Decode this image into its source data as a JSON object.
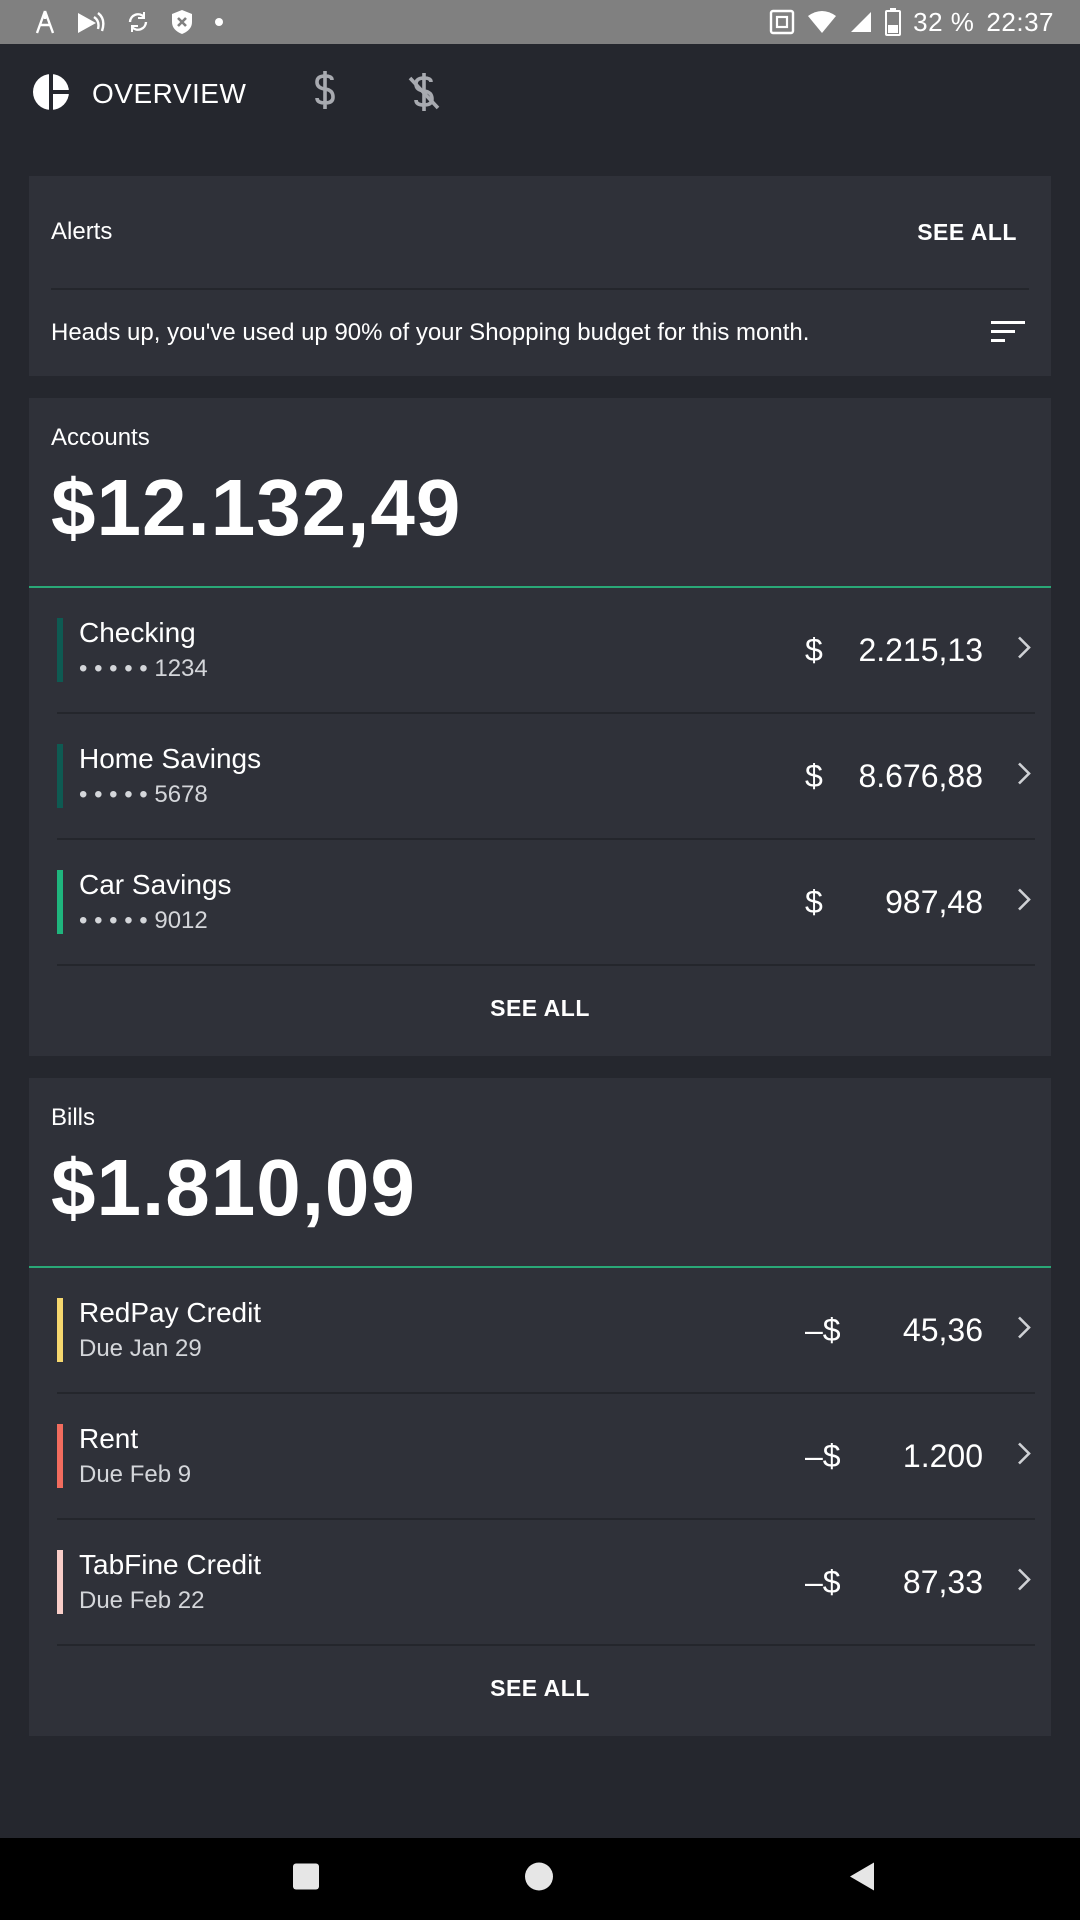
{
  "status_bar": {
    "battery_percent": "32 %",
    "time": "22:37"
  },
  "tabs": {
    "overview_label": "OVERVIEW"
  },
  "alerts": {
    "title": "Alerts",
    "see_all": "SEE ALL",
    "message": "Heads up, you've used up 90% of your Shopping budget for this month."
  },
  "accounts": {
    "title": "Accounts",
    "total": "$12.132,49",
    "see_all": "SEE ALL",
    "items": [
      {
        "name": "Checking",
        "sub": "• • • • • 1234",
        "currency": "$",
        "amount": "2.215,13",
        "color": "#0e5a52"
      },
      {
        "name": "Home Savings",
        "sub": "• • • • • 5678",
        "currency": "$",
        "amount": "8.676,88",
        "color": "#0e5a52"
      },
      {
        "name": "Car Savings",
        "sub": "• • • • • 9012",
        "currency": "$",
        "amount": "987,48",
        "color": "#1fb57d"
      }
    ]
  },
  "bills": {
    "title": "Bills",
    "total": "$1.810,09",
    "see_all": "SEE ALL",
    "items": [
      {
        "name": "RedPay Credit",
        "sub": "Due Jan 29",
        "currency": "–$",
        "amount": "45,36",
        "color": "#f5d76e"
      },
      {
        "name": "Rent",
        "sub": "Due Feb 9",
        "currency": "–$",
        "amount": "1.200",
        "color": "#f26c5e"
      },
      {
        "name": "TabFine Credit",
        "sub": "Due Feb 22",
        "currency": "–$",
        "amount": "87,33",
        "color": "#f8cdc8"
      }
    ]
  },
  "colors": {
    "background": "#25272e",
    "card": "#2f3139",
    "accent": "#2aa877",
    "status_bar": "#808080"
  }
}
